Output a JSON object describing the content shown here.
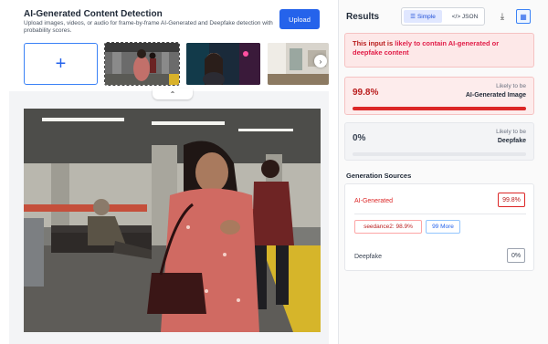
{
  "header": {
    "title": "AI-Generated Content Detection",
    "subtitle": "Upload images, videos, or audio for frame-by-frame AI-Generated and Deepfake detection with probability scores.",
    "upload_label": "Upload"
  },
  "thumbnails": {
    "add_symbol": "+",
    "next_symbol": "›",
    "collapse_symbol": "⌃"
  },
  "results": {
    "title": "Results",
    "toggle_simple": "Simple",
    "toggle_json": "</> JSON",
    "alert_prefix": "This input is ",
    "alert_emphasis": "likely to contain AI-generated or deepfake content",
    "ai": {
      "percent": "99.8%",
      "likely": "Likely to be",
      "label": "AI-Generated Image",
      "fill": 0.998
    },
    "deepfake": {
      "percent": "0%",
      "likely": "Likely to be",
      "label": "Deepfake",
      "fill": 0.0
    }
  },
  "sources": {
    "title": "Generation Sources",
    "ai_label": "AI-Generated",
    "ai_value": "99.8%",
    "chip_model": "seedance2: 98.9%",
    "chip_more": "99 More",
    "deepfake_label": "Deepfake",
    "deepfake_value": "0%"
  },
  "colors": {
    "accent": "#2563eb",
    "danger": "#dc2626",
    "alert_bg": "#fde8e8"
  }
}
